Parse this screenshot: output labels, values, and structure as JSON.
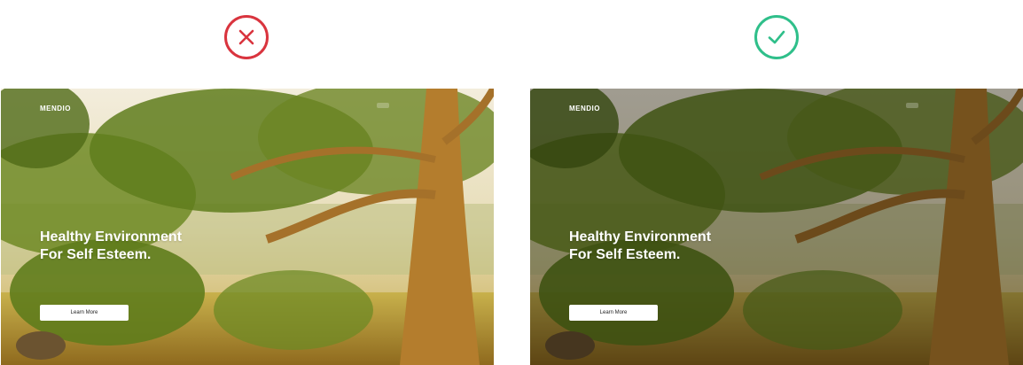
{
  "examples": [
    {
      "verdict": "incorrect",
      "status_color": "#d9343e",
      "icon": "x-icon",
      "overlay": false,
      "site": {
        "brand": "MENDIO",
        "nav_links": [
          "",
          "",
          ""
        ],
        "nav_button": "",
        "hero_title_line1": "Healthy Environment",
        "hero_title_line2": "For Self Esteem.",
        "hero_body": "",
        "cta_label": "Learn More"
      }
    },
    {
      "verdict": "correct",
      "status_color": "#2fbf8a",
      "icon": "check-icon",
      "overlay": true,
      "site": {
        "brand": "MENDIO",
        "nav_links": [
          "",
          "",
          ""
        ],
        "nav_button": "",
        "hero_title_line1": "Healthy Environment",
        "hero_title_line2": "For Self Esteem.",
        "hero_body": "",
        "cta_label": "Learn More"
      }
    }
  ]
}
